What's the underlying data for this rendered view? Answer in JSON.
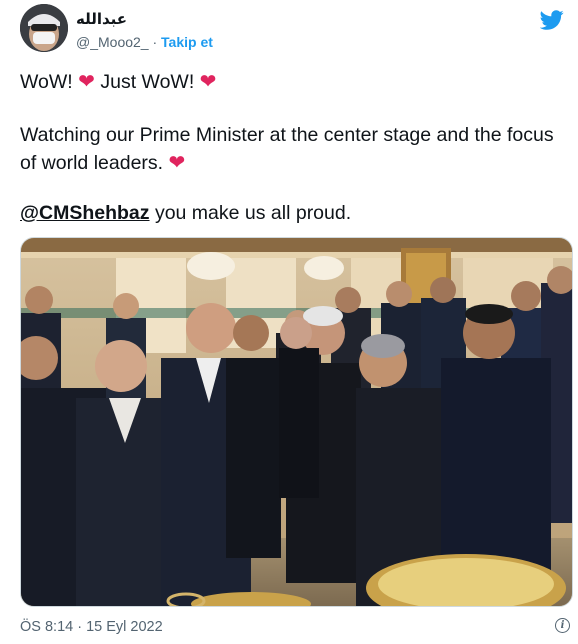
{
  "author": {
    "display_name": "عبدالله",
    "handle": "@_Mooo2_",
    "separator": "·",
    "follow_label": "Takip et"
  },
  "tweet": {
    "line1_a": "WoW!",
    "line1_b": "Just WoW!",
    "heart": "❤",
    "paragraph2": "Watching our Prime Minister at the center stage and the focus of world leaders.",
    "mention": "@CMShehbaz",
    "paragraph3_rest": " you make us all proud."
  },
  "meta": {
    "timestamp": "ÖS 8:14 · 15 Eyl 2022"
  },
  "icons": {
    "platform": "bird-logo-icon",
    "info": "info-icon"
  },
  "colors": {
    "follow": "#1d9bf0",
    "heart": "#e0245e",
    "text": "#0f1419",
    "muted": "#536471"
  }
}
